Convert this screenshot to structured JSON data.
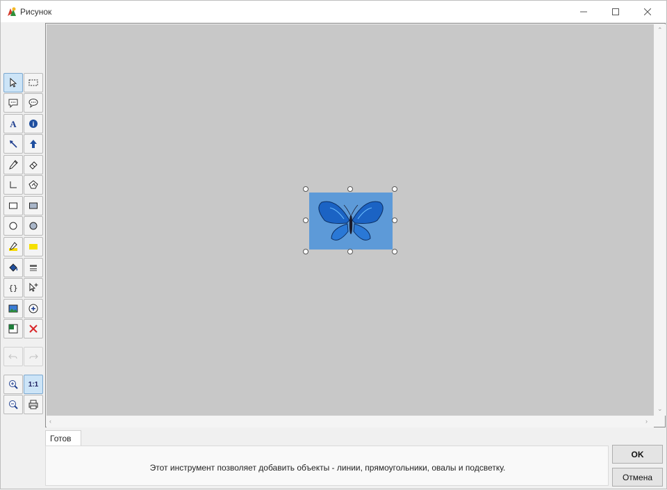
{
  "window": {
    "title": "Рисунок"
  },
  "canvas": {
    "background": "#c8c8c8",
    "image_fill": "#5d9ad8"
  },
  "toolbar": {
    "zoom_reset_label": "1:1",
    "info_label": "i"
  },
  "status": {
    "tab_label": "Готов",
    "message": "Этот инструмент позволяет добавить объекты - линии, прямоугольники, овалы и подсветку."
  },
  "buttons": {
    "ok": "OK",
    "cancel": "Отмена"
  }
}
